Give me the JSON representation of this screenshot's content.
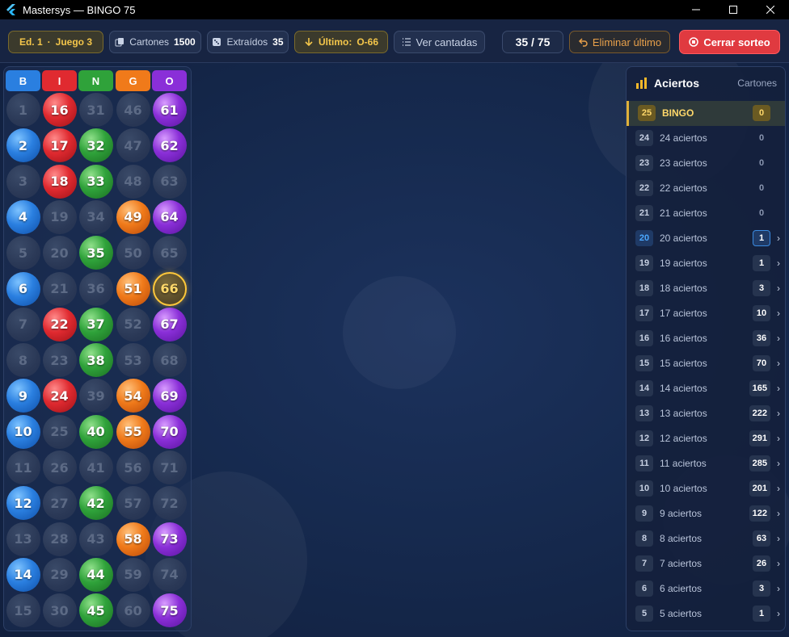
{
  "window": {
    "title": "Mastersys — BINGO 75"
  },
  "toolbar": {
    "edition": "Ed. 1",
    "game": "Juego 3",
    "cartones_label": "Cartones",
    "cartones_value": "1500",
    "extraidos_label": "Extraídos",
    "extraidos_value": "35",
    "ultimo_label": "Último:",
    "ultimo_value": "O-66",
    "ver_cantadas": "Ver cantadas",
    "counter": "35 / 75",
    "eliminar": "Eliminar último",
    "cerrar": "Cerrar sorteo"
  },
  "board": {
    "columns": [
      "B",
      "I",
      "N",
      "G",
      "O"
    ],
    "column_colors": [
      "#2a7fe0",
      "#e02a30",
      "#2fa23a",
      "#f07a1a",
      "#8a2fd8"
    ],
    "drawn": [
      2,
      4,
      6,
      9,
      10,
      12,
      14,
      16,
      17,
      18,
      22,
      24,
      32,
      33,
      35,
      37,
      38,
      40,
      42,
      44,
      45,
      49,
      51,
      54,
      55,
      58,
      61,
      62,
      64,
      66,
      67,
      69,
      70,
      73,
      75
    ],
    "last": 66,
    "numbers": [
      [
        1,
        16,
        31,
        46,
        61
      ],
      [
        2,
        17,
        32,
        47,
        62
      ],
      [
        3,
        18,
        33,
        48,
        63
      ],
      [
        4,
        19,
        34,
        49,
        64
      ],
      [
        5,
        20,
        35,
        50,
        65
      ],
      [
        6,
        21,
        36,
        51,
        66
      ],
      [
        7,
        22,
        37,
        52,
        67
      ],
      [
        8,
        23,
        38,
        53,
        68
      ],
      [
        9,
        24,
        39,
        54,
        69
      ],
      [
        10,
        25,
        40,
        55,
        70
      ],
      [
        11,
        26,
        41,
        56,
        71
      ],
      [
        12,
        27,
        42,
        57,
        72
      ],
      [
        13,
        28,
        43,
        58,
        73
      ],
      [
        14,
        29,
        44,
        59,
        74
      ],
      [
        15,
        30,
        45,
        60,
        75
      ]
    ]
  },
  "aciertos": {
    "title": "Aciertos",
    "subtitle": "Cartones",
    "rows": [
      {
        "num": "25",
        "label": "BINGO",
        "count": "0",
        "type": "bingo"
      },
      {
        "num": "24",
        "label": "24 aciertos",
        "count": "0",
        "type": "zero"
      },
      {
        "num": "23",
        "label": "23 aciertos",
        "count": "0",
        "type": "zero"
      },
      {
        "num": "22",
        "label": "22 aciertos",
        "count": "0",
        "type": "zero"
      },
      {
        "num": "21",
        "label": "21 aciertos",
        "count": "0",
        "type": "zero"
      },
      {
        "num": "20",
        "label": "20 aciertos",
        "count": "1",
        "type": "hl"
      },
      {
        "num": "19",
        "label": "19 aciertos",
        "count": "1",
        "type": "normal"
      },
      {
        "num": "18",
        "label": "18 aciertos",
        "count": "3",
        "type": "normal"
      },
      {
        "num": "17",
        "label": "17 aciertos",
        "count": "10",
        "type": "normal"
      },
      {
        "num": "16",
        "label": "16 aciertos",
        "count": "36",
        "type": "normal"
      },
      {
        "num": "15",
        "label": "15 aciertos",
        "count": "70",
        "type": "normal"
      },
      {
        "num": "14",
        "label": "14 aciertos",
        "count": "165",
        "type": "normal"
      },
      {
        "num": "13",
        "label": "13 aciertos",
        "count": "222",
        "type": "normal"
      },
      {
        "num": "12",
        "label": "12 aciertos",
        "count": "291",
        "type": "normal"
      },
      {
        "num": "11",
        "label": "11 aciertos",
        "count": "285",
        "type": "normal"
      },
      {
        "num": "10",
        "label": "10 aciertos",
        "count": "201",
        "type": "normal"
      },
      {
        "num": "9",
        "label": "9 aciertos",
        "count": "122",
        "type": "normal"
      },
      {
        "num": "8",
        "label": "8 aciertos",
        "count": "63",
        "type": "normal"
      },
      {
        "num": "7",
        "label": "7 aciertos",
        "count": "26",
        "type": "normal"
      },
      {
        "num": "6",
        "label": "6 aciertos",
        "count": "3",
        "type": "normal"
      },
      {
        "num": "5",
        "label": "5 aciertos",
        "count": "1",
        "type": "normal"
      }
    ]
  }
}
